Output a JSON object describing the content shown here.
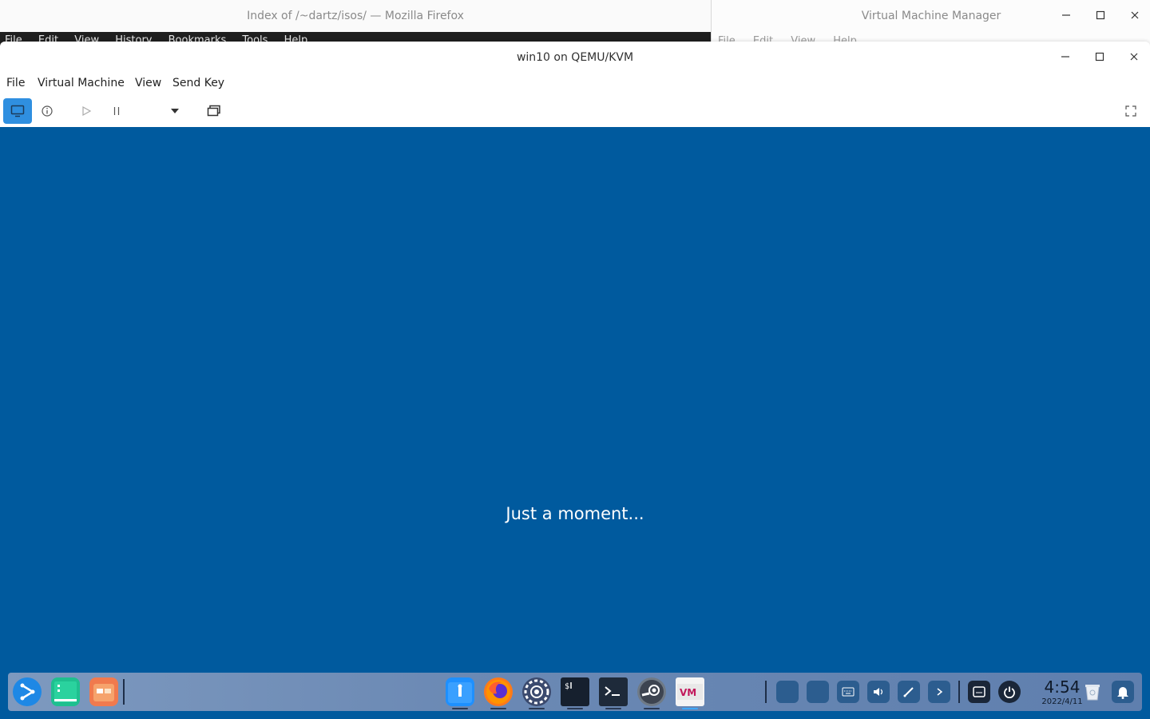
{
  "firefox": {
    "title": "Index of /~dartz/isos/ — Mozilla Firefox",
    "menu": [
      "File",
      "Edit",
      "View",
      "History",
      "Bookmarks",
      "Tools",
      "Help"
    ]
  },
  "vmm": {
    "title": "Virtual Machine Manager",
    "menu": [
      "File",
      "Edit",
      "View",
      "Help"
    ]
  },
  "window": {
    "title": "win10 on QEMU/KVM",
    "menu": [
      "File",
      "Virtual Machine",
      "View",
      "Send Key"
    ]
  },
  "toolbar": {
    "icons": [
      "console-icon",
      "details-icon",
      "run-icon",
      "pause-icon",
      "shutdown-dropdown-icon",
      "snapshots-icon",
      "fullscreen-icon"
    ]
  },
  "guest": {
    "message": "Just a moment..."
  },
  "clock": {
    "time": "4:54",
    "date": "2022/4/11"
  },
  "colors": {
    "guest_bg": "#005a9e",
    "accent": "#2f8fe0"
  }
}
